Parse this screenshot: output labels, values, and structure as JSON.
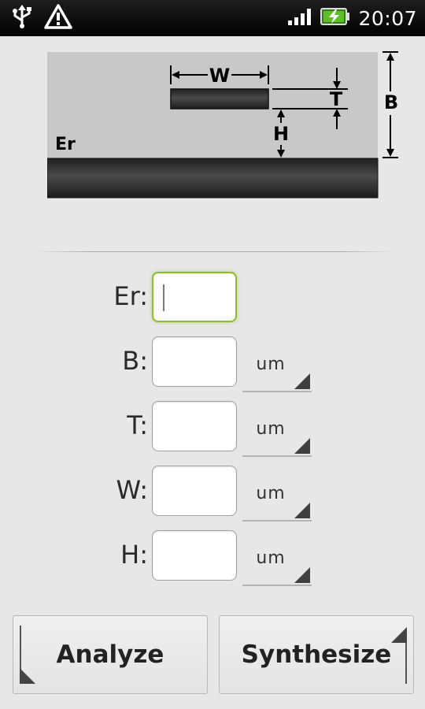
{
  "status_bar": {
    "time": "20:07",
    "icons": [
      "usb-icon",
      "warning-icon",
      "signal-icon",
      "battery-charging-icon"
    ]
  },
  "diagram": {
    "labels": {
      "w": "W",
      "t": "T",
      "b": "B",
      "h": "H",
      "er": "Er"
    }
  },
  "form": {
    "fields": [
      {
        "label": "Er:",
        "value": "",
        "unit": null
      },
      {
        "label": "B:",
        "value": "",
        "unit": "um"
      },
      {
        "label": "T:",
        "value": "",
        "unit": "um"
      },
      {
        "label": "W:",
        "value": "",
        "unit": "um"
      },
      {
        "label": "H:",
        "value": "",
        "unit": "um"
      }
    ]
  },
  "buttons": {
    "analyze": "Analyze",
    "synthesize": "Synthesize"
  }
}
